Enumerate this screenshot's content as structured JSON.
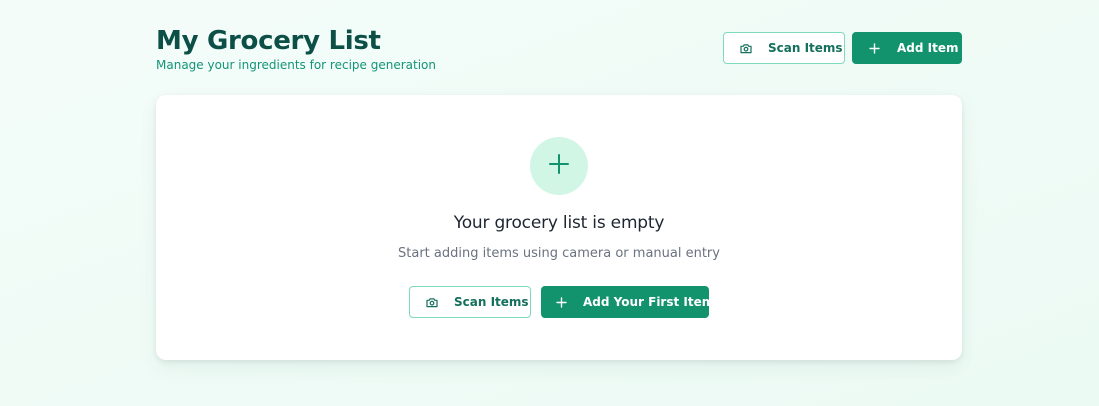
{
  "header": {
    "title": "My Grocery List",
    "subtitle": "Manage your ingredients for recipe generation",
    "scan_button_label": "Scan Items",
    "add_button_label": "Add Item"
  },
  "empty_state": {
    "title": "Your grocery list is empty",
    "description": "Start adding items using camera or manual entry",
    "scan_button_label": "Scan Items",
    "add_first_button_label": "Add Your First Item"
  },
  "icons": {
    "scan": "camera-icon",
    "add": "plus-icon",
    "empty": "plus-icon"
  },
  "colors": {
    "brand": "#12936d",
    "title": "#0b4f47",
    "subtitle": "#149478",
    "outline_border": "#7fd9bd",
    "empty_circle": "#d2f6e6",
    "muted_text": "#6a7280"
  }
}
